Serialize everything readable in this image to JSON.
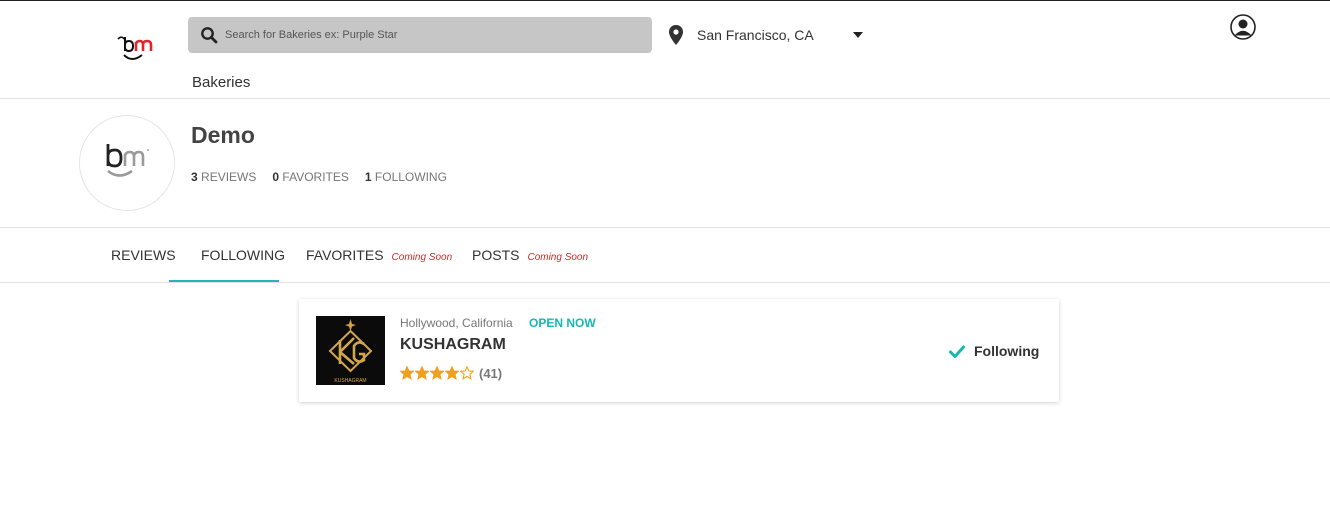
{
  "header": {
    "search": {
      "placeholder": "Search for Bakeries ex: Purple Star"
    },
    "location": "San Francisco, CA",
    "nav": {
      "bakeries": "Bakeries"
    }
  },
  "profile": {
    "name": "Demo",
    "stats": [
      {
        "count": "3",
        "label": "REVIEWS"
      },
      {
        "count": "0",
        "label": "FAVORITES"
      },
      {
        "count": "1",
        "label": "FOLLOWING"
      }
    ]
  },
  "tabs": [
    {
      "label": "REVIEWS",
      "badge": ""
    },
    {
      "label": "FOLLOWING",
      "badge": ""
    },
    {
      "label": "FAVORITES",
      "badge": "Coming Soon"
    },
    {
      "label": "POSTS",
      "badge": "Coming Soon"
    }
  ],
  "active_tab": "FOLLOWING",
  "following": [
    {
      "location": "Hollywood, California",
      "status": "OPEN NOW",
      "name": "KUSHAGRAM",
      "logo_text": "KUSHAGRAM",
      "rating": 4,
      "rating_max": 5,
      "review_count": "(41)",
      "follow_label": "Following"
    }
  ],
  "colors": {
    "accent": "#21b5b5",
    "open_status": "#18b7b3",
    "coming_soon": "#e02424",
    "star": "#f0a11b",
    "brand_red": "#e0262c"
  }
}
